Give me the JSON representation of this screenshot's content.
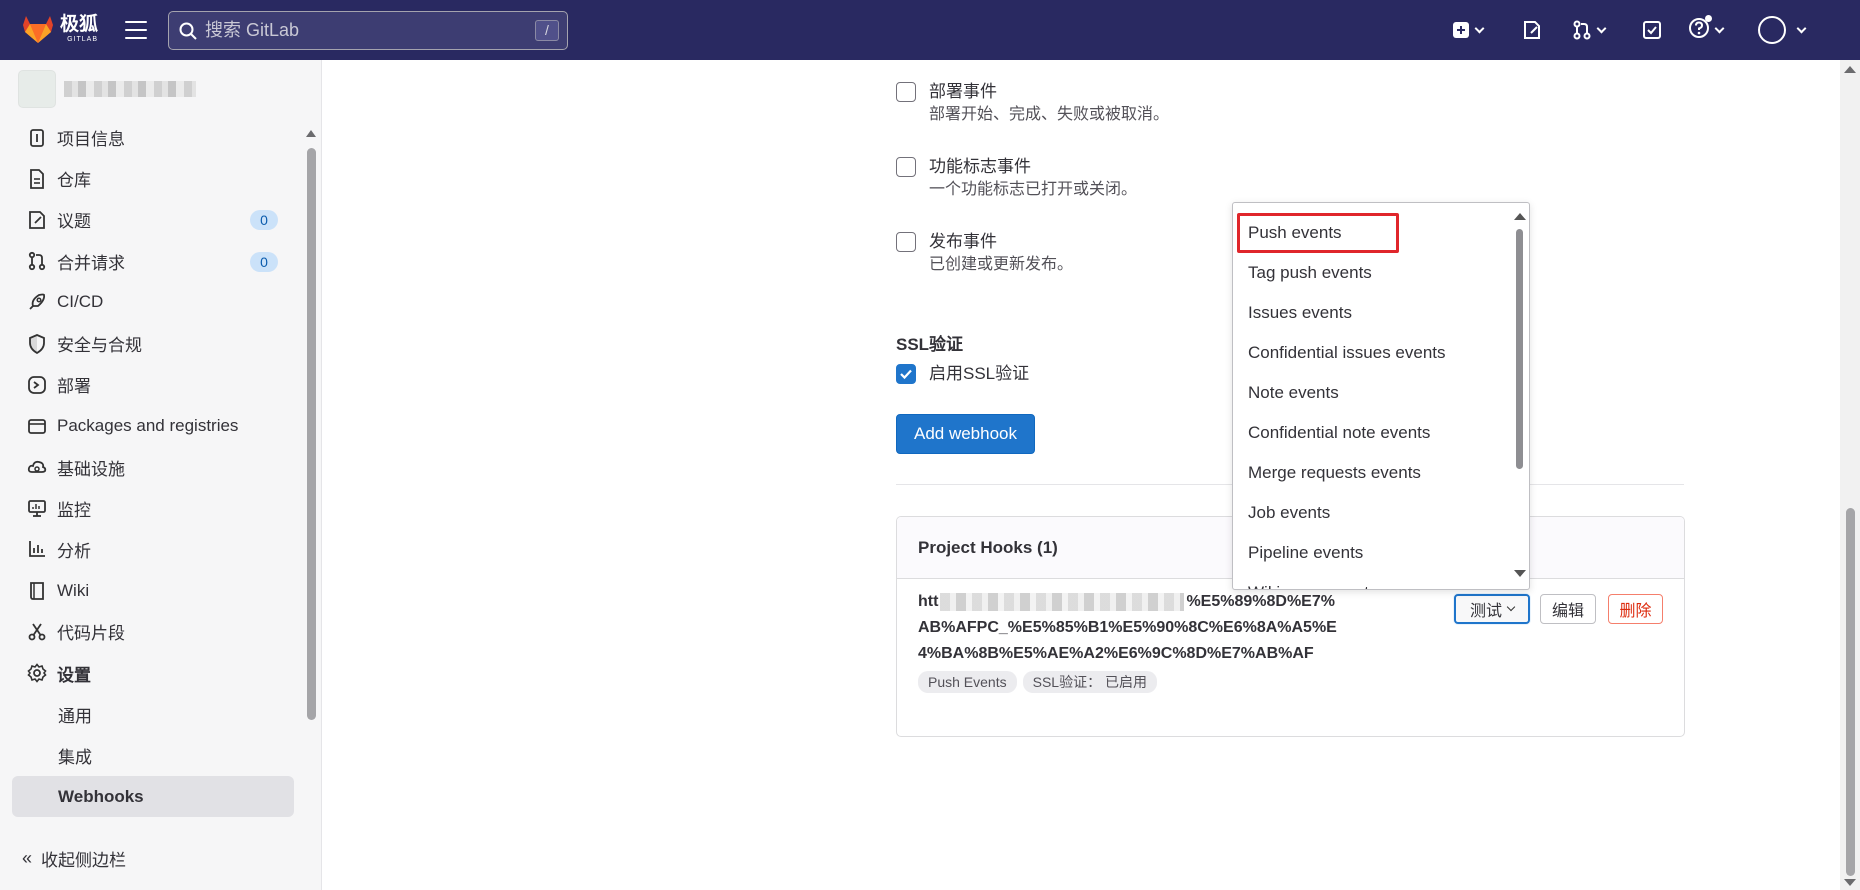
{
  "header": {
    "logo_text": "极狐",
    "logo_sub": "GITLAB",
    "search_placeholder": "搜索 GitLab",
    "search_shortcut": "/"
  },
  "sidebar": {
    "items": [
      {
        "label": "项目信息",
        "icon": "info-icon"
      },
      {
        "label": "仓库",
        "icon": "document-icon"
      },
      {
        "label": "议题",
        "icon": "issues-icon",
        "badge": "0"
      },
      {
        "label": "合并请求",
        "icon": "merge-request-icon",
        "badge": "0"
      },
      {
        "label": "CI/CD",
        "icon": "rocket-icon"
      },
      {
        "label": "安全与合规",
        "icon": "shield-icon"
      },
      {
        "label": "部署",
        "icon": "deploy-icon"
      },
      {
        "label": "Packages and registries",
        "icon": "package-icon"
      },
      {
        "label": "基础设施",
        "icon": "cloud-icon"
      },
      {
        "label": "监控",
        "icon": "monitor-icon"
      },
      {
        "label": "分析",
        "icon": "chart-icon"
      },
      {
        "label": "Wiki",
        "icon": "book-icon"
      },
      {
        "label": "代码片段",
        "icon": "scissors-icon"
      },
      {
        "label": "设置",
        "icon": "settings-icon"
      }
    ],
    "sub_items": [
      "通用",
      "集成",
      "Webhooks"
    ],
    "collapse_label": "收起侧边栏"
  },
  "events": [
    {
      "title": "部署事件",
      "desc": "部署开始、完成、失败或被取消。",
      "checked": false
    },
    {
      "title": "功能标志事件",
      "desc": "一个功能标志已打开或关闭。",
      "checked": false
    },
    {
      "title": "发布事件",
      "desc": "已创建或更新发布。",
      "checked": false
    }
  ],
  "ssl": {
    "section_title": "SSL验证",
    "checkbox_label": "启用SSL验证",
    "checked": true
  },
  "add_webhook_label": "Add webhook",
  "project_hooks": {
    "title": "Project Hooks (1)",
    "hook": {
      "url_prefix": "htt",
      "url_rest": "%E5%89%8D%E7%AB%AFPC_%E5%85%B1%E5%90%8C%E6%8A%A5%E4%BA%8B%E5%AE%A2%E6%9C%8D%E7%AB%AF",
      "tags": [
        "Push Events",
        "SSL验证：  已启用"
      ],
      "test_label": "测试",
      "edit_label": "编辑",
      "delete_label": "删除"
    }
  },
  "dropdown": {
    "items": [
      "Push events",
      "Tag push events",
      "Issues events",
      "Confidential issues events",
      "Note events",
      "Confidential note events",
      "Merge requests events",
      "Job events",
      "Pipeline events",
      "Wiki page events"
    ],
    "highlighted": "Push events"
  },
  "colors": {
    "topbar": "#292961",
    "primary": "#1f75cb",
    "danger": "#dd2b0e",
    "highlight_border": "#e0262b"
  }
}
